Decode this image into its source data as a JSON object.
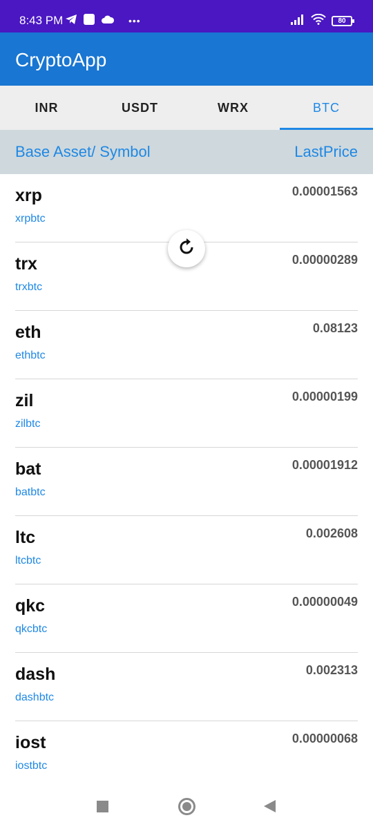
{
  "status_bar": {
    "time": "8:43 PM",
    "overflow": "•••",
    "battery_level": "80",
    "icons": [
      "telegram-icon",
      "notification-square-icon",
      "cloud-icon",
      "signal-icon",
      "wifi-icon",
      "battery-icon"
    ]
  },
  "app_bar": {
    "title": "CryptoApp"
  },
  "tabs": [
    {
      "label": "INR"
    },
    {
      "label": "USDT"
    },
    {
      "label": "WRX"
    },
    {
      "label": "BTC"
    }
  ],
  "active_tab": "BTC",
  "list_header": {
    "left": "Base Asset/ Symbol",
    "right": "LastPrice"
  },
  "rows": [
    {
      "base": "xrp",
      "symbol": "xrpbtc",
      "price": "0.00001563"
    },
    {
      "base": "trx",
      "symbol": "trxbtc",
      "price": "0.00000289"
    },
    {
      "base": "eth",
      "symbol": "ethbtc",
      "price": "0.08123"
    },
    {
      "base": "zil",
      "symbol": "zilbtc",
      "price": "0.00000199"
    },
    {
      "base": "bat",
      "symbol": "batbtc",
      "price": "0.00001912"
    },
    {
      "base": "ltc",
      "symbol": "ltcbtc",
      "price": "0.002608"
    },
    {
      "base": "qkc",
      "symbol": "qkcbtc",
      "price": "0.00000049"
    },
    {
      "base": "dash",
      "symbol": "dashbtc",
      "price": "0.002313"
    },
    {
      "base": "iost",
      "symbol": "iostbtc",
      "price": "0.00000068"
    }
  ],
  "colors": {
    "status_bar": "#4a17c2",
    "app_bar": "#1976d2",
    "accent": "#1e88e5",
    "header_bg": "#cfd8dc",
    "tab_bg": "#eeeeee"
  }
}
